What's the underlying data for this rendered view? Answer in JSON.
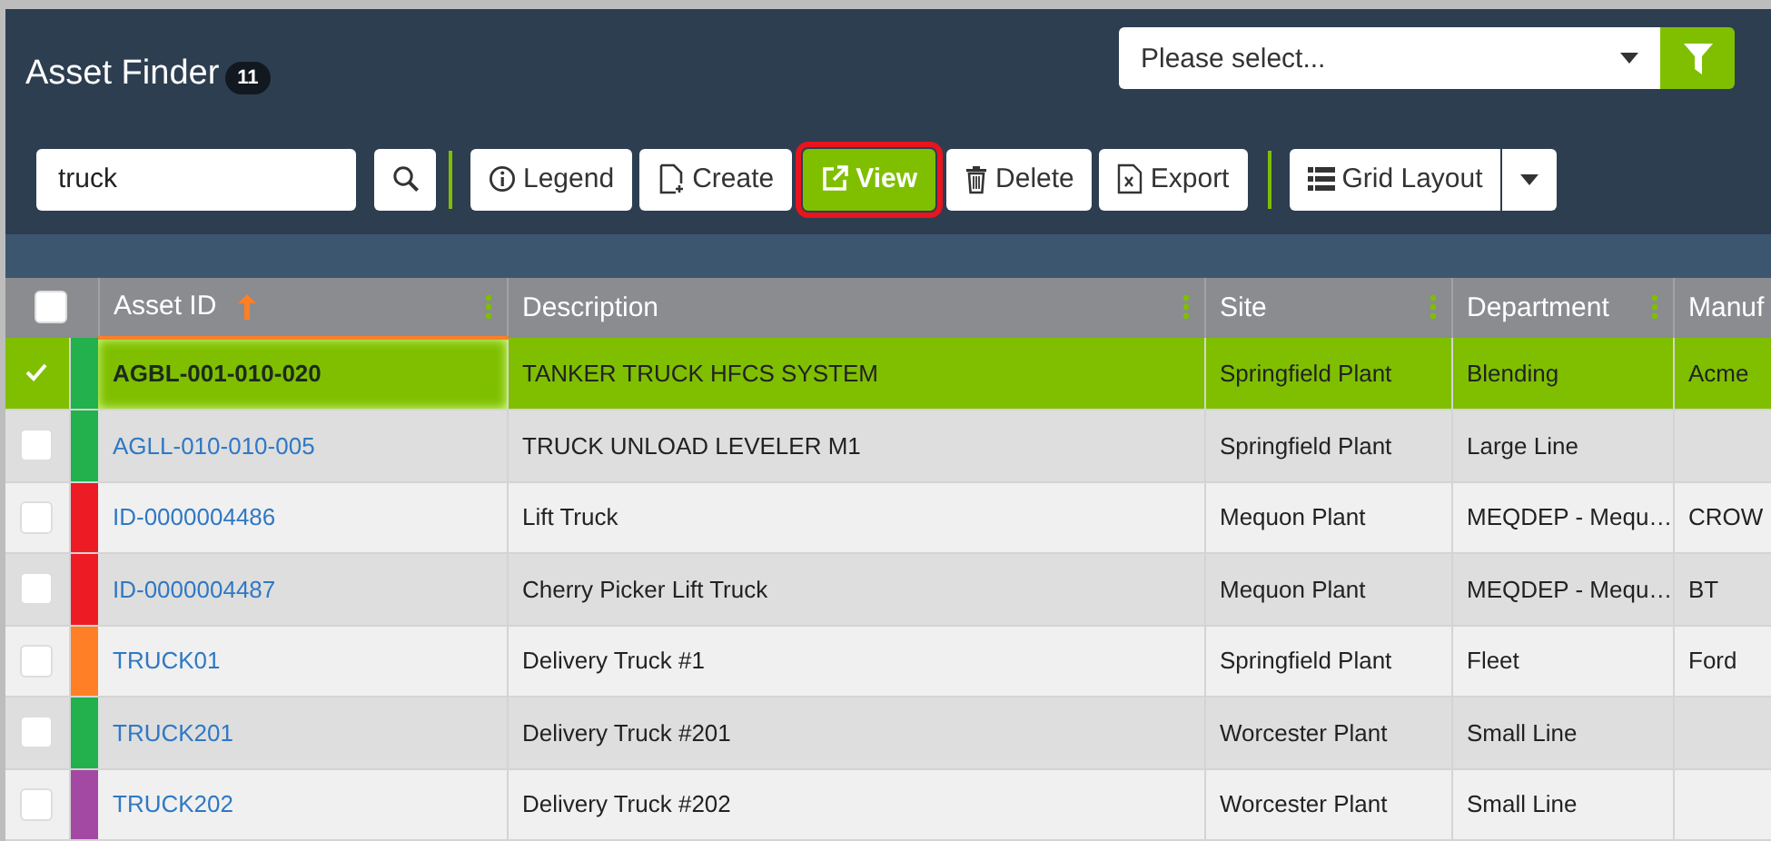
{
  "header": {
    "title": "Asset Finder",
    "count": "11",
    "select": {
      "placeholder": "Please select..."
    }
  },
  "toolbar": {
    "search": {
      "value": "truck"
    },
    "buttons": [
      {
        "kind": "legend",
        "label": "Legend",
        "highlighted": false
      },
      {
        "kind": "create",
        "label": "Create",
        "highlighted": false
      },
      {
        "kind": "view",
        "label": "View",
        "highlighted": true
      },
      {
        "kind": "delete",
        "label": "Delete",
        "highlighted": false
      },
      {
        "kind": "export",
        "label": "Export",
        "highlighted": false
      }
    ],
    "layout": {
      "label": "Grid Layout"
    }
  },
  "table": {
    "select_all": {
      "checked": false
    },
    "columns": [
      {
        "label": "Asset ID",
        "sorted": true,
        "menu": true
      },
      {
        "label": "Description",
        "sorted": false,
        "menu": true
      },
      {
        "label": "Site",
        "sorted": false,
        "menu": true
      },
      {
        "label": "Department",
        "sorted": false,
        "menu": true
      },
      {
        "label": "Manuf",
        "sorted": false,
        "menu": false
      }
    ],
    "rows": [
      {
        "selected": true,
        "color": "#22b14c",
        "cells": [
          "AGBL-001-010-020",
          "TANKER TRUCK HFCS SYSTEM",
          "Springfield Plant",
          "Blending",
          "Acme"
        ]
      },
      {
        "selected": false,
        "color": "#22b14c",
        "cells": [
          "AGLL-010-010-005",
          "TRUCK UNLOAD LEVELER M1",
          "Springfield Plant",
          "Large Line"
        ]
      },
      {
        "selected": false,
        "color": "#ed1c24",
        "cells": [
          "ID-0000004486",
          "Lift Truck",
          "Mequon Plant",
          "MEQDEP - Mequ…",
          "CROW"
        ]
      },
      {
        "selected": false,
        "color": "#ed1c24",
        "cells": [
          "ID-0000004487",
          "Cherry Picker Lift Truck",
          "Mequon Plant",
          "MEQDEP - Mequ…",
          "BT"
        ]
      },
      {
        "selected": false,
        "color": "#ff7f27",
        "cells": [
          "TRUCK01",
          "Delivery Truck #1",
          "Springfield Plant",
          "Fleet",
          "Ford"
        ]
      },
      {
        "selected": false,
        "color": "#22b14c",
        "cells": [
          "TRUCK201",
          "Delivery Truck #201",
          "Worcester Plant",
          "Small Line"
        ]
      },
      {
        "selected": false,
        "color": "#a349a4",
        "cells": [
          "TRUCK202",
          "Delivery Truck #202",
          "Worcester Plant",
          "Small Line"
        ]
      }
    ]
  }
}
